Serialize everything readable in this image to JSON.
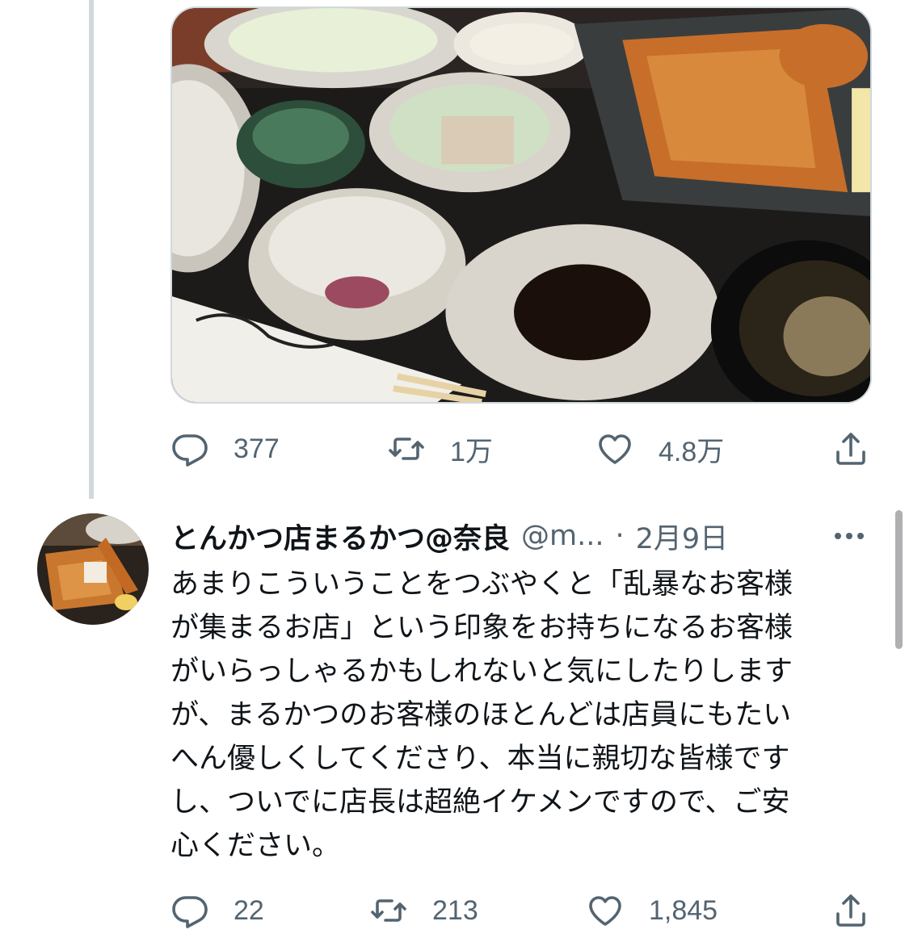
{
  "tweet1": {
    "actions": {
      "reply_count": "377",
      "retweet_count": "1万",
      "like_count": "4.8万"
    }
  },
  "tweet2": {
    "display_name": "とんかつ店まるかつ@奈良",
    "handle": "@m...",
    "separator": "·",
    "date": "2月9日",
    "text_lines": [
      "あまりこういうことをつぶやくと「乱暴なお客様",
      "が集まるお店」という印象をお持ちになるお客様",
      "がいらっしゃるかもしれないと気にしたりします",
      "が、まるかつのお客様のほとんどは店員にもたい",
      "へん優しくしてくださり、本当に親切な皆様です",
      "し、ついでに店長は超絶イケメンですので、ご安",
      "心ください。"
    ],
    "actions": {
      "reply_count": "22",
      "retweet_count": "213",
      "like_count": "1,845"
    }
  },
  "colors": {
    "text_primary": "#0f1419",
    "text_secondary": "#536471",
    "border": "#cfd9de"
  },
  "icons": {
    "reply": "reply-icon",
    "retweet": "retweet-icon",
    "like": "heart-icon",
    "share": "share-icon",
    "more": "more-icon"
  }
}
